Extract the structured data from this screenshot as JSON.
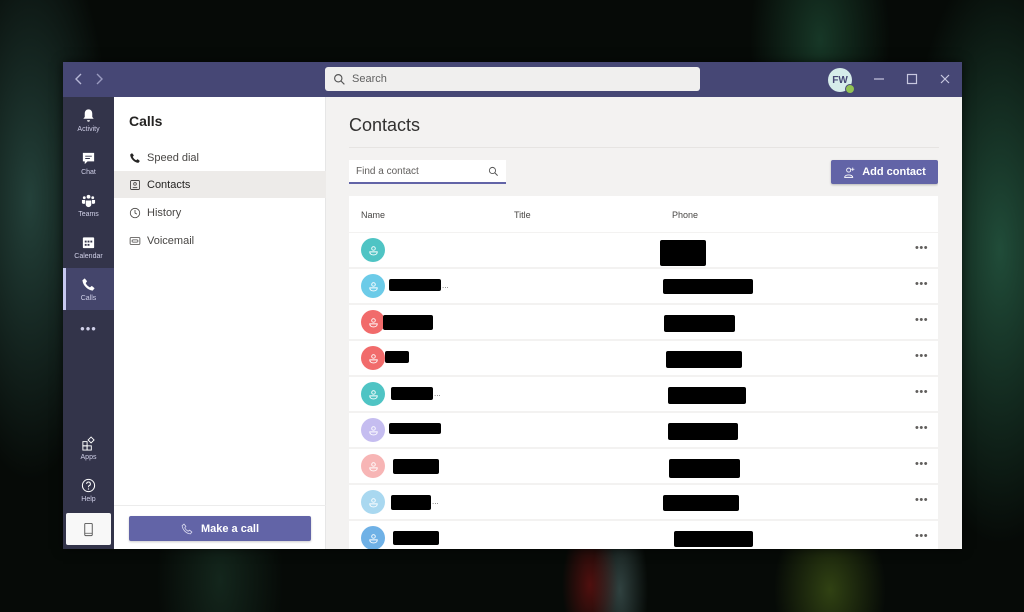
{
  "titlebar": {
    "back_icon": "chevron-left-icon",
    "forward_icon": "chevron-right-icon",
    "search_placeholder": "Search",
    "user_initials": "FW",
    "presence_status": "available",
    "minimize_icon": "minimize-icon",
    "maximize_icon": "maximize-icon",
    "close_icon": "close-icon"
  },
  "rail": {
    "items": [
      {
        "label": "Activity",
        "icon": "bell-icon",
        "active": false
      },
      {
        "label": "Chat",
        "icon": "chat-icon",
        "active": false
      },
      {
        "label": "Teams",
        "icon": "teams-icon",
        "active": false
      },
      {
        "label": "Calendar",
        "icon": "calendar-icon",
        "active": false
      },
      {
        "label": "Calls",
        "icon": "phone-icon",
        "active": true
      }
    ],
    "more_label": "•••",
    "bottom_items": [
      {
        "label": "Apps",
        "icon": "apps-icon"
      },
      {
        "label": "Help",
        "icon": "help-icon"
      }
    ],
    "device_icon": "mobile-device-icon"
  },
  "panel": {
    "title": "Calls",
    "items": [
      {
        "label": "Speed dial",
        "icon": "phone-icon",
        "active": false
      },
      {
        "label": "Contacts",
        "icon": "contact-card-icon",
        "active": true
      },
      {
        "label": "History",
        "icon": "clock-icon",
        "active": false
      },
      {
        "label": "Voicemail",
        "icon": "voicemail-icon",
        "active": false
      }
    ],
    "make_call_label": "Make a call"
  },
  "main": {
    "title": "Contacts",
    "find_placeholder": "Find a contact",
    "add_contact_label": "Add contact",
    "columns": [
      "Name",
      "Title",
      "Phone"
    ],
    "more_label": "•••",
    "rows": [
      {
        "avatar_color": "#4fc4c4",
        "name": "[redacted]",
        "name_truncated": false,
        "title": "",
        "phone": "[redacted]"
      },
      {
        "avatar_color": "#6ccbe8",
        "name": "[redacted]",
        "name_truncated": true,
        "title": "",
        "phone": "[redacted]"
      },
      {
        "avatar_color": "#f16b6b",
        "name": "[redacted]",
        "name_truncated": false,
        "title": "",
        "phone": "[redacted]"
      },
      {
        "avatar_color": "#f16b6b",
        "name": "[redacted]",
        "name_truncated": false,
        "title": "",
        "phone": "[redacted]"
      },
      {
        "avatar_color": "#4fc4c4",
        "name": "[redacted]",
        "name_truncated": true,
        "title": "",
        "phone": "[redacted]"
      },
      {
        "avatar_color": "#c5bdf0",
        "name": "[redacted]",
        "name_truncated": false,
        "title": "",
        "phone": "[redacted]"
      },
      {
        "avatar_color": "#f7b5b5",
        "name": "[redacted]",
        "name_truncated": false,
        "title": "",
        "phone": "[redacted]"
      },
      {
        "avatar_color": "#a9d8f0",
        "name": "[redacted]",
        "name_truncated": true,
        "title": "",
        "phone": "[redacted]"
      },
      {
        "avatar_color": "#6fb1e6",
        "name": "[redacted]",
        "name_truncated": false,
        "title": "",
        "phone": "[redacted]"
      }
    ]
  },
  "colors": {
    "titlebar": "#464775",
    "rail": "#33344a",
    "accent": "#6264a7",
    "presence": "#92c353"
  }
}
